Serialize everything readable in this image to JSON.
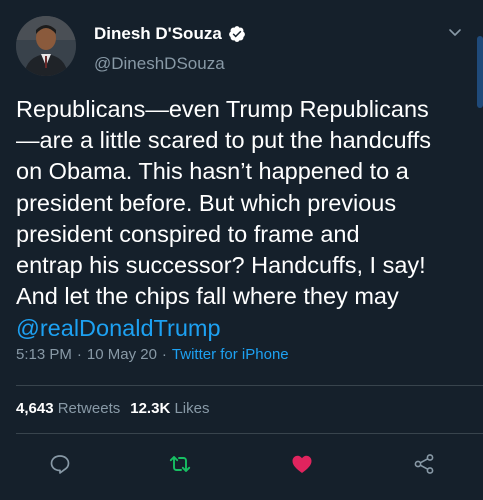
{
  "user": {
    "display_name": "Dinesh D'Souza",
    "handle": "@DineshDSouza",
    "verified": true
  },
  "tweet": {
    "text": "Republicans—even Trump Republicans\n—are a little scared to put the handcuffs\non Obama. This hasn’t happened to a\npresident before. But which previous\npresident conspired to frame and\nentrap his successor? Handcuffs, I say!\nAnd let the chips fall where they may",
    "mention": "@realDonaldTrump"
  },
  "meta": {
    "time": "5:13 PM",
    "date": "10 May 20",
    "separator": "·",
    "source": "Twitter for iPhone"
  },
  "stats": {
    "retweets_count": "4,643",
    "retweets_label": "Retweets",
    "likes_count": "12.3K",
    "likes_label": "Likes"
  },
  "icons": {
    "more": "chevron-down-icon",
    "reply": "reply-icon",
    "retweet": "retweet-icon",
    "like": "heart-icon",
    "share": "share-icon",
    "verified": "verified-badge-icon"
  },
  "colors": {
    "background": "#15202b",
    "accent": "#1da1f2",
    "secondary_text": "#8899a6",
    "retweet_active": "#17bf63",
    "like_active": "#e0245e"
  }
}
